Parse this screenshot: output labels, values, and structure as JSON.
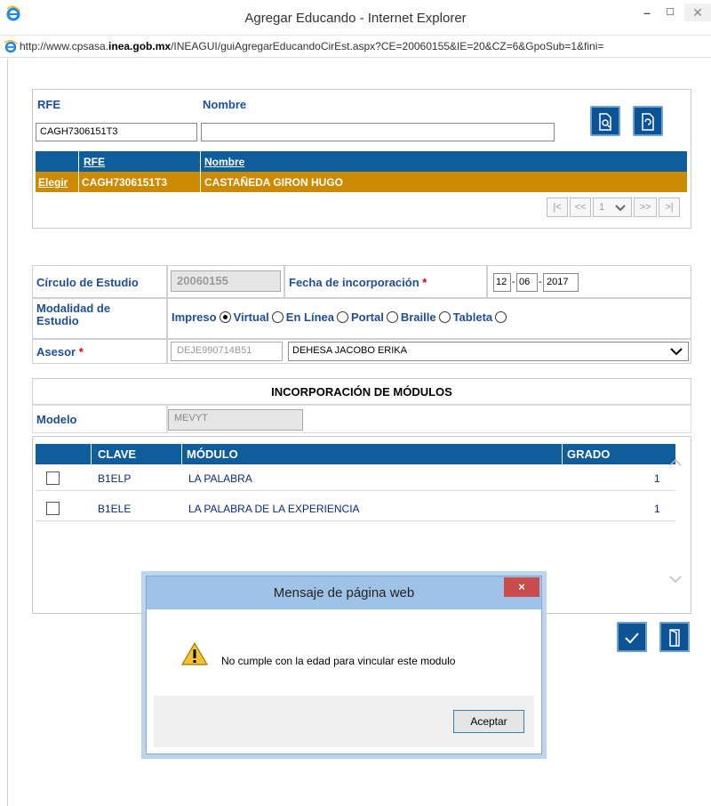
{
  "window": {
    "title": "Agregar Educando - Internet Explorer",
    "url_prefix": "http://www.cpsasa.",
    "url_domain": "inea.gob.mx",
    "url_rest": "/INEAGUI/guiAgregarEducandoCirEst.aspx?CE=20060155&IE=20&CZ=6&GpoSub=1&fini="
  },
  "search": {
    "rfe_label": "RFE",
    "nombre_label": "Nombre",
    "rfe_value": "CAGH7306151T3",
    "nombre_value": ""
  },
  "results": {
    "headers": [
      "RFE",
      "Nombre"
    ],
    "row": {
      "action": "Elegir",
      "rfe": "CAGH7306151T3",
      "nombre": "CASTAÑEDA GIRON HUGO"
    },
    "pager": {
      "first": "|<",
      "prev": "<<",
      "page": "1",
      "next": ">>",
      "last": ">|"
    }
  },
  "form": {
    "circulo_label": "Círculo de Estudio",
    "circulo_value": "20060155",
    "fecha_label": "Fecha de incorporación",
    "required_mark": "*",
    "fecha_day": "12",
    "fecha_month": "06",
    "fecha_year": "2017",
    "modalidad_label": "Modalidad de Estudio",
    "modalidad_options": [
      "Impreso",
      "Virtual",
      "En Línea",
      "Portal",
      "Braille",
      "Tableta"
    ],
    "modalidad_selected": "Impreso",
    "asesor_label": "Asesor",
    "asesor_rfe": "DEJE990714B51",
    "asesor_name": "DEHESA JACOBO ERIKA"
  },
  "modulos": {
    "section_title": "INCORPORACIÓN DE MÓDULOS",
    "modelo_label": "Modelo",
    "modelo_value": "MEVYT",
    "headers": [
      "CLAVE",
      "MÓDULO",
      "GRADO"
    ],
    "rows": [
      {
        "clave": "B1ELP",
        "modulo": "LA PALABRA",
        "grado": "1"
      },
      {
        "clave": "B1ELE",
        "modulo": "LA PALABRA DE LA EXPERIENCIA",
        "grado": "1"
      }
    ]
  },
  "dialog": {
    "title": "Mensaje de página web",
    "message": "No cumple con la edad para vincular este modulo",
    "ok_label": "Aceptar",
    "close_glyph": "×"
  }
}
